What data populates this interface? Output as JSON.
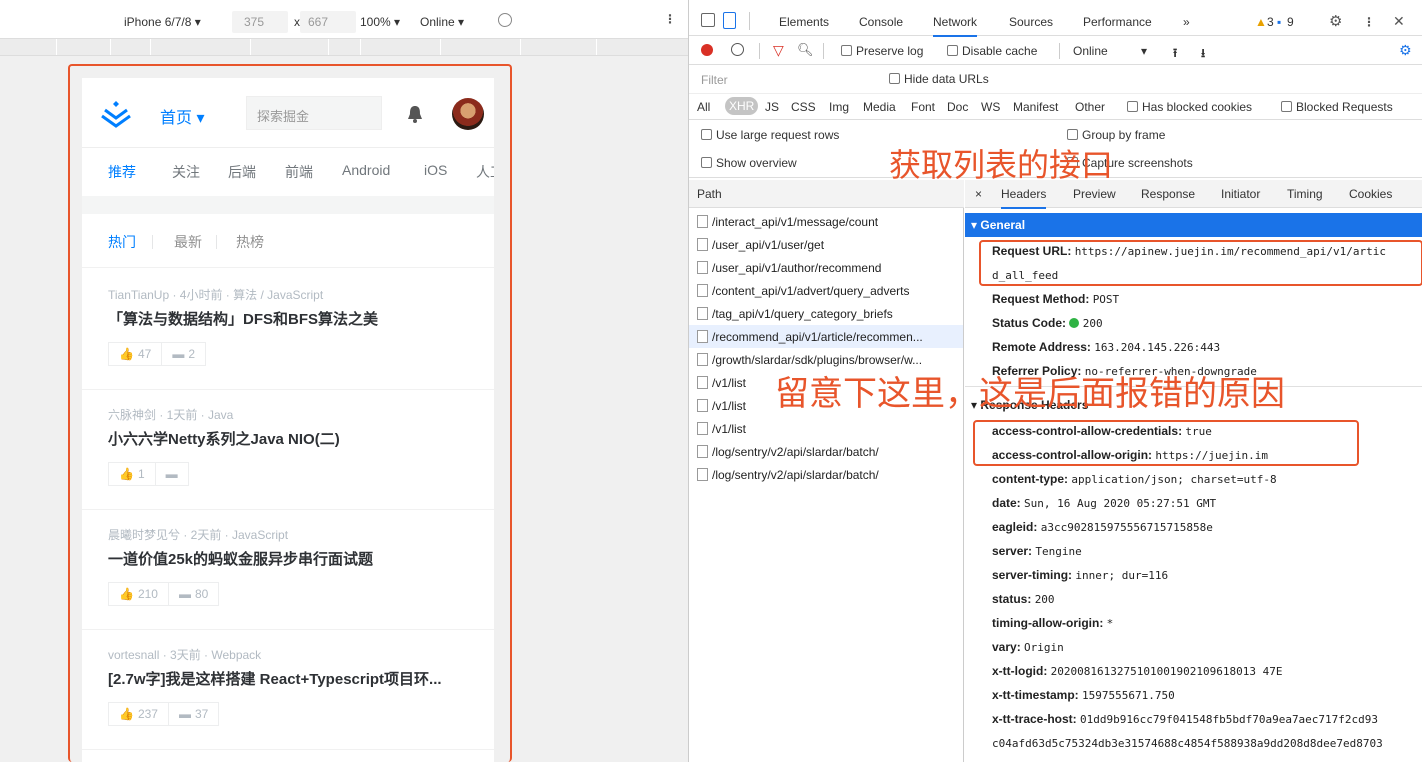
{
  "device_toolbar": {
    "device": "iPhone 6/7/8 ▾",
    "width": "375",
    "times": "x",
    "height": "667",
    "zoom": "100% ▾",
    "network": "Online ▾"
  },
  "juejin": {
    "home_label": "首页 ▾",
    "search_placeholder": "探索掘金",
    "nav_tabs": [
      "推荐",
      "关注",
      "后端",
      "前端",
      "Android",
      "iOS",
      "人工"
    ],
    "sub_tabs": [
      "热门",
      "最新",
      "热榜"
    ],
    "articles": [
      {
        "meta": "TianTianUp · 4小时前 · 算法 / JavaScript",
        "title": "「算法与数据结构」DFS和BFS算法之美",
        "likes": "47",
        "comments": "2"
      },
      {
        "meta": "六脉神剑 · 1天前 · Java",
        "title": "小六六学Netty系列之Java NIO(二)",
        "likes": "1",
        "comments": ""
      },
      {
        "meta": "晨曦时梦见兮 · 2天前 · JavaScript",
        "title": "一道价值25k的蚂蚁金服异步串行面试题",
        "likes": "210",
        "comments": "80"
      },
      {
        "meta": "vortesnall · 3天前 · Webpack",
        "title": "[2.7w字]我是这样搭建 React+Typescript项目环...",
        "likes": "237",
        "comments": "37"
      }
    ]
  },
  "devtools": {
    "tabs": [
      "Elements",
      "Console",
      "Network",
      "Sources",
      "Performance",
      "»"
    ],
    "active_tab": "Network",
    "warnings": "3",
    "messages": "9",
    "toolbar": {
      "preserve_log": "Preserve log",
      "disable_cache": "Disable cache",
      "throttle": "Online",
      "throttle_caret": "▾"
    },
    "filter_placeholder": "Filter",
    "hide_data_urls": "Hide data URLs",
    "types": [
      "All",
      "XHR",
      "JS",
      "CSS",
      "Img",
      "Media",
      "Font",
      "Doc",
      "WS",
      "Manifest",
      "Other"
    ],
    "has_blocked_cookies": "Has blocked cookies",
    "blocked_requests": "Blocked Requests",
    "large_rows": "Use large request rows",
    "group_by_frame": "Group by frame",
    "show_overview": "Show overview",
    "capture_screenshots": "Capture screenshots",
    "path_header": "Path",
    "requests": [
      "/interact_api/v1/message/count",
      "/user_api/v1/user/get",
      "/user_api/v1/author/recommend",
      "/content_api/v1/advert/query_adverts",
      "/tag_api/v1/query_category_briefs",
      "/recommend_api/v1/article/recommen...",
      "/growth/slardar/sdk/plugins/browser/w...",
      "/v1/list",
      "/v1/list",
      "/v1/list",
      "/log/sentry/v2/api/slardar/batch/",
      "/log/sentry/v2/api/slardar/batch/"
    ],
    "detail_tabs": [
      "×",
      "Headers",
      "Preview",
      "Response",
      "Initiator",
      "Timing",
      "Cookies"
    ],
    "general_title": "▾ General",
    "general": [
      {
        "k": "Request URL:",
        "v": "https://apinew.juejin.im/recommend_api/v1/artic"
      },
      {
        "k": "",
        "v": "d_all_feed"
      },
      {
        "k": "Request Method:",
        "v": "POST"
      },
      {
        "k": "Status Code:",
        "v": "200"
      },
      {
        "k": "Remote Address:",
        "v": "163.204.145.226:443"
      },
      {
        "k": "Referrer Policy:",
        "v": "no-referrer-when-downgrade"
      }
    ],
    "response_headers_title": "▾ Response Headers",
    "response_headers": [
      {
        "k": "access-control-allow-credentials:",
        "v": "true"
      },
      {
        "k": "access-control-allow-origin:",
        "v": "https://juejin.im"
      },
      {
        "k": "content-type:",
        "v": "application/json; charset=utf-8"
      },
      {
        "k": "date:",
        "v": "Sun, 16 Aug 2020 05:27:51 GMT"
      },
      {
        "k": "eagleid:",
        "v": "a3cc902815975556715715858e"
      },
      {
        "k": "server:",
        "v": "Tengine"
      },
      {
        "k": "server-timing:",
        "v": "inner; dur=116"
      },
      {
        "k": "status:",
        "v": "200"
      },
      {
        "k": "timing-allow-origin:",
        "v": "*"
      },
      {
        "k": "vary:",
        "v": "Origin"
      },
      {
        "k": "x-tt-logid:",
        "v": "2020081613275101001902109618013 47E"
      },
      {
        "k": "x-tt-timestamp:",
        "v": "1597555671.750"
      },
      {
        "k": "x-tt-trace-host:",
        "v": "01dd9b916cc79f041548fb5bdf70a9ea7aec717f2cd93"
      },
      {
        "k": "",
        "v": "c04afd63d5c75324db3e31574688c4854f588938a9dd208d8dee7ed8703"
      }
    ]
  },
  "annotations": {
    "get_list_api": "获取列表的接口",
    "note_here": "留意下这里，这是后面报错的原因"
  },
  "colors": {
    "annotation": "#e8552b",
    "juejin_blue": "#007fff",
    "devtools_blue": "#1a73e8"
  }
}
